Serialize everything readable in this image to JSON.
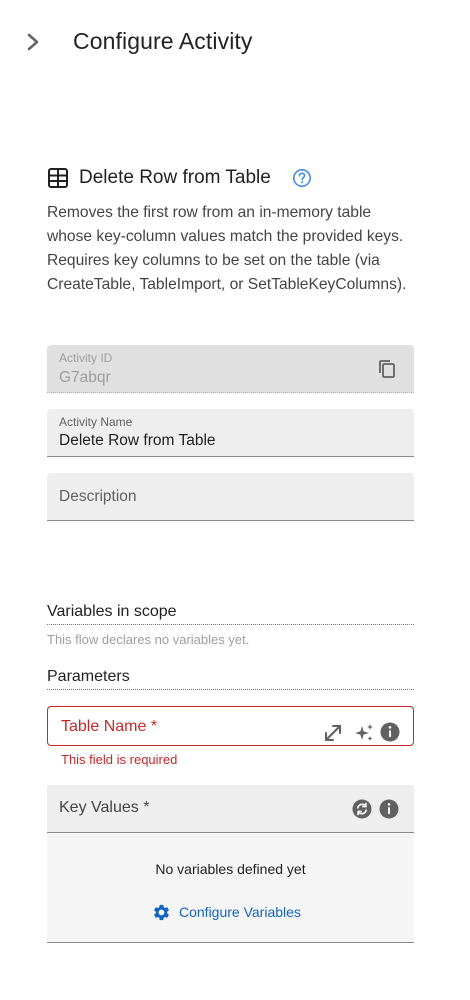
{
  "header": {
    "title": "Configure Activity",
    "collapse_icon": "chevron-right-icon"
  },
  "activity": {
    "icon": "table-icon",
    "title": "Delete Row from Table",
    "help_icon": "help-circle-icon",
    "description": "Removes the first row from an in-memory table whose key-column values match the provided keys. Requires key columns to be set on the table (via CreateTable, TableImport, or SetTableKeyColumns)."
  },
  "fields": {
    "activity_id": {
      "label": "Activity ID",
      "value": "G7abqr",
      "icon": "copy-icon"
    },
    "activity_name": {
      "label": "Activity Name",
      "value": "Delete Row from Table"
    },
    "description": {
      "placeholder": "Description"
    }
  },
  "variables": {
    "title": "Variables in scope",
    "empty_text": "This flow declares no variables yet."
  },
  "parameters": {
    "title": "Parameters",
    "table_name": {
      "label": "Table Name *",
      "error": "This field is required",
      "icons": [
        "expand-icon",
        "ai-sparkle-icon",
        "info-icon"
      ]
    },
    "key_values": {
      "label": "Key Values *",
      "icons": [
        "toggle-mode-icon",
        "info-icon"
      ],
      "empty_text": "No variables defined yet",
      "configure_label": "Configure Variables"
    }
  },
  "colors": {
    "error": "#c62828",
    "accent": "#1565c0",
    "help": "#4a90e2"
  }
}
